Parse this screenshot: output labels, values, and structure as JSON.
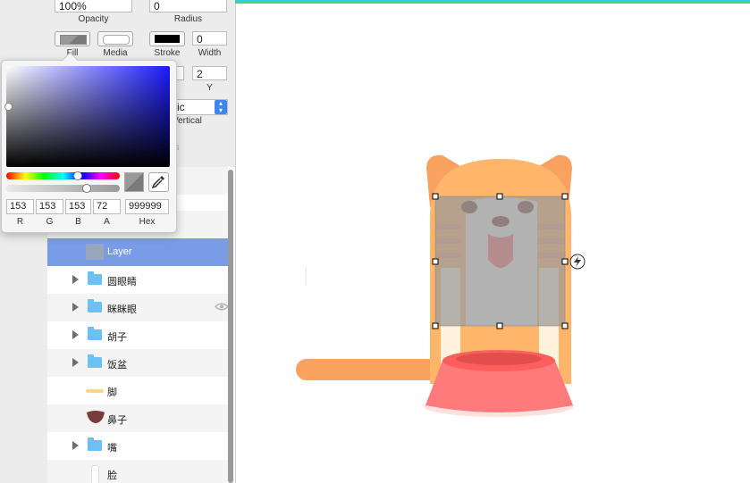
{
  "inspector": {
    "opacity_value": "100%",
    "opacity_label": "Opacity",
    "radius_value": "0",
    "radius_label": "Radius",
    "fill_label": "Fill",
    "media_label": "Media",
    "stroke_label": "Stroke",
    "width_value": "0",
    "width_label": "Width",
    "y_value": "2",
    "y_label": "Y",
    "select_text": "ic",
    "vertical_label": "Vertical",
    "stroke_color": "#000000"
  },
  "color_picker": {
    "r": "153",
    "g": "153",
    "b": "153",
    "a": "72",
    "hex": "999999",
    "r_label": "R",
    "g_label": "G",
    "b_label": "B",
    "a_label": "A",
    "hex_label": "Hex",
    "hue_color": "#1b1bff"
  },
  "layers": [
    {
      "name": "Layer",
      "type": "layer",
      "selected": true,
      "expandable": false
    },
    {
      "name": "圆眼睛",
      "type": "folder",
      "expandable": true
    },
    {
      "name": "眯眯眼",
      "type": "folder",
      "expandable": true,
      "visibility_icon": "eye-icon"
    },
    {
      "name": "胡子",
      "type": "folder",
      "expandable": true
    },
    {
      "name": "饭盆",
      "type": "folder",
      "expandable": true
    },
    {
      "name": "脚",
      "type": "shape",
      "expandable": false
    },
    {
      "name": "鼻子",
      "type": "shape",
      "expandable": false
    },
    {
      "name": "嘴",
      "type": "folder",
      "expandable": true
    },
    {
      "name": "脸",
      "type": "shape",
      "expandable": false
    }
  ],
  "canvas": {
    "guide_colors": [
      "#38c8e6",
      "#4fd27a"
    ],
    "cat_color": "#ffb66b",
    "tail_color": "#f9a25f",
    "bowl_color": "#ff7b7b",
    "selection_fill": "#999999"
  }
}
